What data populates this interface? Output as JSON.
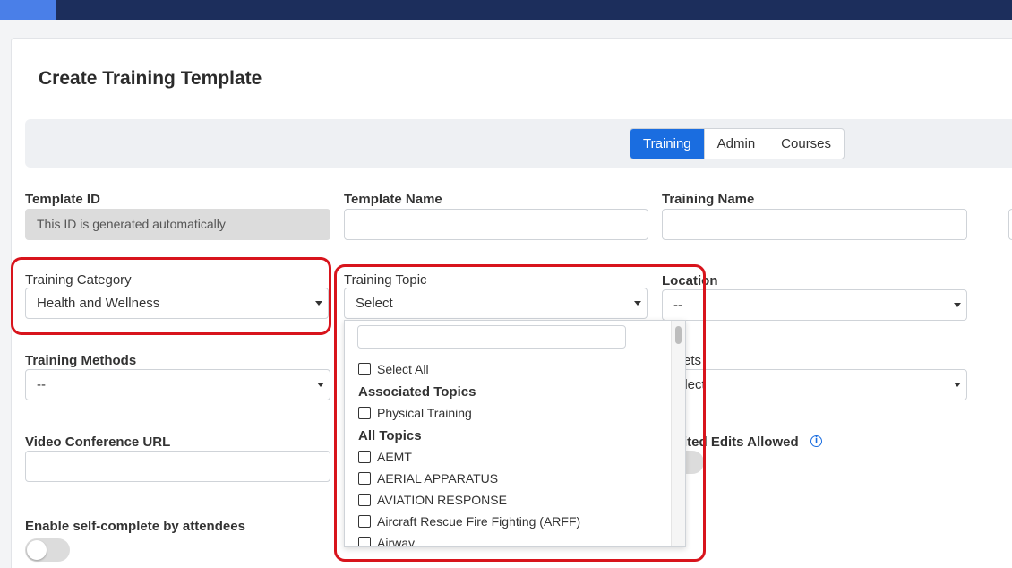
{
  "page": {
    "title": "Create Training Template"
  },
  "tabs": [
    {
      "label": "Training",
      "active": true
    },
    {
      "label": "Admin",
      "active": false
    },
    {
      "label": "Courses",
      "active": false
    }
  ],
  "fields": {
    "template_id": {
      "label": "Template ID",
      "placeholder": "This ID is generated automatically"
    },
    "template_name": {
      "label": "Template Name",
      "value": ""
    },
    "training_name": {
      "label": "Training Name",
      "value": ""
    },
    "training_category": {
      "label": "Training Category",
      "value": "Health and Wellness"
    },
    "training_topic": {
      "label": "Training Topic",
      "value": "Select"
    },
    "location": {
      "label": "Location",
      "value": "--"
    },
    "training_methods": {
      "label": "Training Methods",
      "value": "--"
    },
    "right_select_partial": {
      "label_visible": "ets",
      "value_visible": "elect"
    },
    "video_conference_url": {
      "label": "Video Conference URL",
      "value": ""
    },
    "edits_allowed": {
      "label_visible": "ited Edits Allowed"
    },
    "self_complete": {
      "label": "Enable self-complete by attendees",
      "enabled": false
    }
  },
  "topic_dropdown": {
    "search_value": "",
    "select_all": "Select All",
    "groups": [
      {
        "title": "Associated Topics",
        "items": [
          "Physical Training"
        ]
      },
      {
        "title": "All Topics",
        "items": [
          "AEMT",
          "AERIAL APPARATUS",
          "AVIATION RESPONSE",
          "Aircraft Rescue Fire Fighting (ARFF)",
          "Airway"
        ]
      }
    ]
  },
  "icons": {
    "info": "info-icon",
    "caret": "chevron-down-icon"
  },
  "colors": {
    "primary": "#1a6de0",
    "topbar": "#1c2e5c",
    "highlight": "#d8141c"
  }
}
